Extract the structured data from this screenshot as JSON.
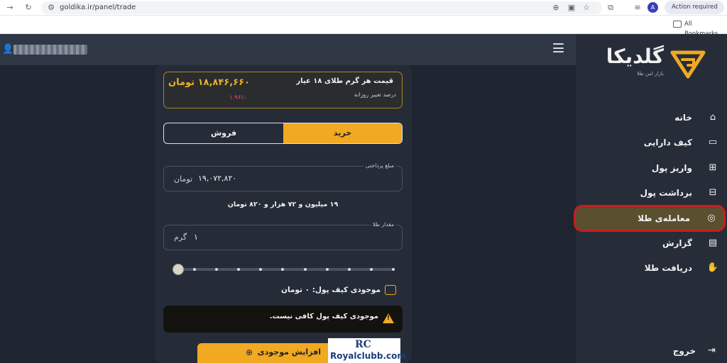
{
  "browser": {
    "url": "goldika.ir/panel/trade",
    "action_required": "Action required",
    "avatar_letter": "A",
    "bookmarks_label": "All Bookmarks"
  },
  "brand": {
    "name": "گلدیکا",
    "tagline": "بازار امن طلا",
    "accent": "#f1a922"
  },
  "sidebar": {
    "items": [
      {
        "label": "خانه",
        "icon": "home-icon"
      },
      {
        "label": "کیف دارایی",
        "icon": "wallet-icon"
      },
      {
        "label": "واریز پول",
        "icon": "deposit-icon"
      },
      {
        "label": "برداشت پول",
        "icon": "withdraw-icon"
      },
      {
        "label": "معامله‌ی طلا",
        "icon": "gold-trade-icon",
        "active": true
      },
      {
        "label": "گزارش",
        "icon": "report-icon"
      },
      {
        "label": "دریافت طلا",
        "icon": "receive-gold-icon"
      }
    ],
    "logout_label": "خروج"
  },
  "price": {
    "title": "قیمت هر گرم طلای ۱۸ عیار",
    "value": "۱۸,۸۴۶,۶۶۰ تومان",
    "change_label": "درصد تغییر روزانه",
    "change_value": "-۱.۹۶٪",
    "change_color": "#e45b62"
  },
  "tabs": {
    "buy": "خرید",
    "sell": "فروش",
    "selected": "buy"
  },
  "payment": {
    "legend": "مبلغ پرداختی",
    "value": "۱۹,۰۷۲,۸۲۰",
    "unit": "تومان",
    "in_words": "۱۹ میلیون و ۷۲ هزار و ۸۲۰ تومان"
  },
  "gold_amount": {
    "legend": "مقدار طلا",
    "value": "۱",
    "unit": "گرم"
  },
  "slider": {
    "position_fraction": 0
  },
  "wallet": {
    "balance_text": "موجودی کیف پول: ۰ تومان"
  },
  "warning": {
    "text": "موجودی کیف پول کافی نیست."
  },
  "cta": {
    "label": "افزایش موجودی"
  },
  "watermark": {
    "mark": "RC",
    "site": "Royalclubb.com"
  }
}
